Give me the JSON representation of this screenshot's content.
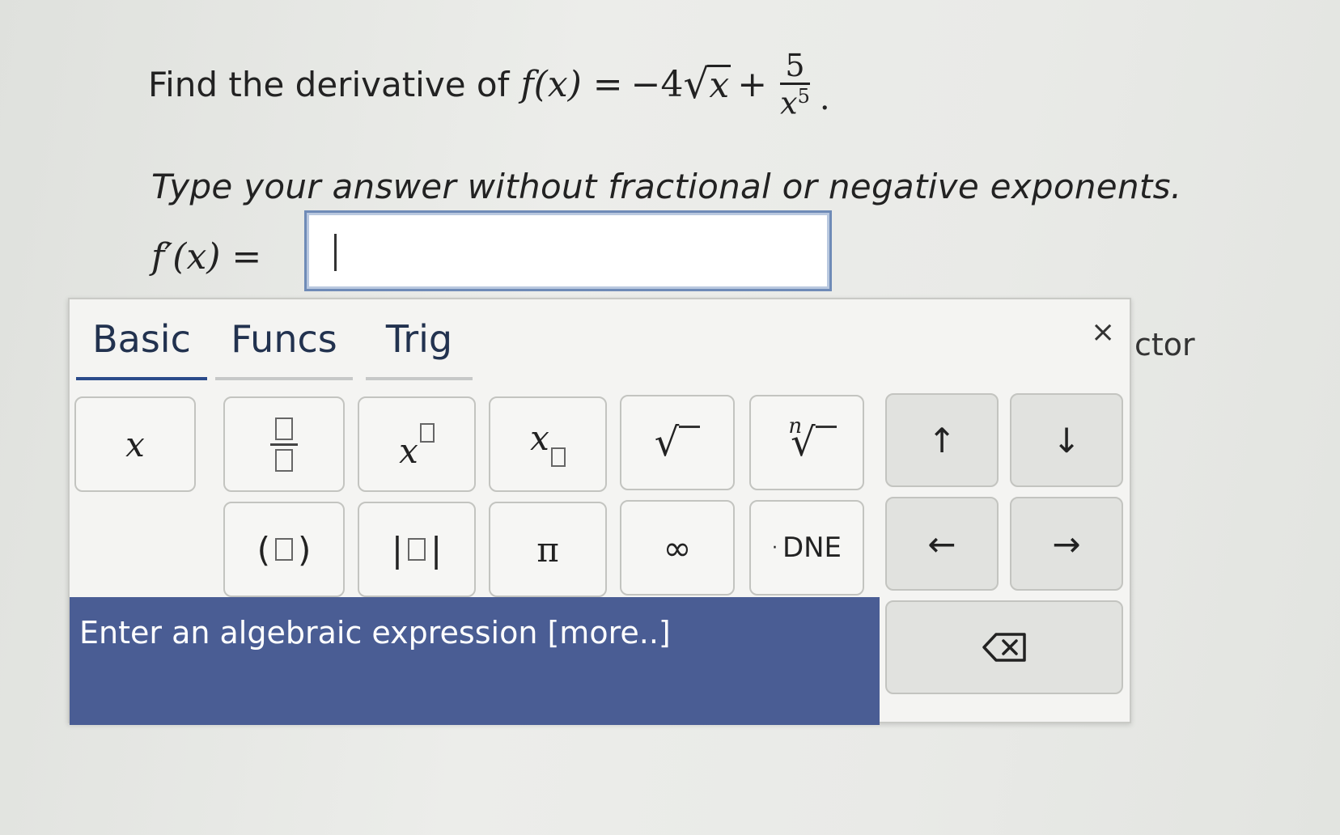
{
  "question": {
    "prompt": "Find the derivative of",
    "function_lhs": "f(x) =",
    "coefficient": "−4",
    "radicand": "x",
    "plus": "+",
    "frac_num": "5",
    "frac_den_base": "x",
    "frac_den_exp": "5",
    "period": "."
  },
  "instruction": "Type your answer without fractional or negative exponents.",
  "answer": {
    "label": "f′(x) =",
    "value": ""
  },
  "side_text": "ctor",
  "palette": {
    "tabs": [
      {
        "label": "Basic",
        "active": true
      },
      {
        "label": "Funcs",
        "active": false
      },
      {
        "label": "Trig",
        "active": false
      }
    ],
    "close": "×",
    "keys": {
      "x": "x",
      "x_base": "x",
      "paren_open": "(",
      "paren_close": ")",
      "abs_bar": "|",
      "pi": "π",
      "infinity": "∞",
      "dne": "DNE",
      "up": "↑",
      "down": "↓",
      "left": "←",
      "right": "→",
      "sqrt": "√",
      "nth_index": "n",
      "nth_root": "√"
    },
    "hint": "Enter an algebraic expression [more..]"
  }
}
